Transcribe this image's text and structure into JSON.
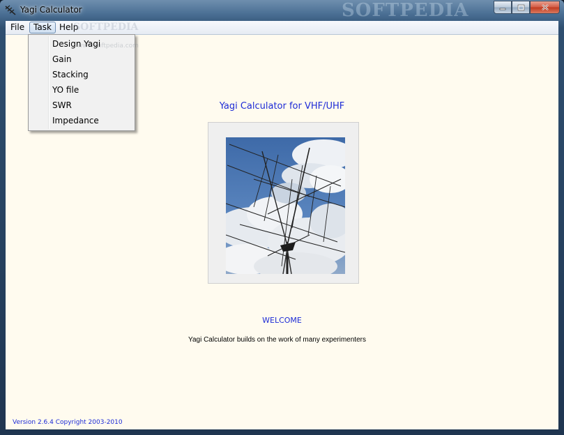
{
  "window": {
    "title": "Yagi Calculator",
    "watermark": "SOFTPEDIA",
    "buttons": [
      "minimize",
      "maximize",
      "close"
    ]
  },
  "menubar": {
    "items": [
      {
        "label": "File"
      },
      {
        "label": "Task",
        "active": true
      },
      {
        "label": "Help"
      }
    ],
    "watermark": "SOFTPEDIA"
  },
  "task_menu": {
    "items": [
      {
        "label": "Design Yagi"
      },
      {
        "label": "Gain"
      },
      {
        "label": "Stacking"
      },
      {
        "label": "YO file"
      },
      {
        "label": "SWR"
      },
      {
        "label": "Impedance"
      }
    ]
  },
  "main": {
    "heading": "Yagi Calculator  for VHF/UHF",
    "welcome": "WELCOME",
    "tagline": "Yagi Calculator  builds on the work of many experimenters",
    "version": "Version 2.6.4 Copyright 2003-2010"
  },
  "colors": {
    "accent_text": "#1d2bd6",
    "client_background": "#fffbef",
    "menu_background": "#f1f1f1"
  }
}
